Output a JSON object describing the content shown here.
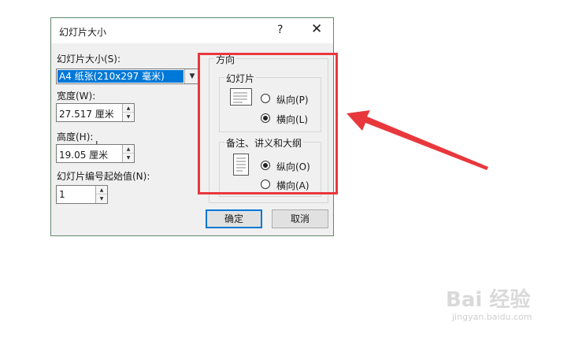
{
  "dialog": {
    "title": "幻灯片大小",
    "help_label": "?",
    "close_label": "✕",
    "slide_size_label": "幻灯片大小(S):",
    "slide_size_value": "A4 纸张(210x297 毫米)",
    "width_label": "宽度(W):",
    "width_value": "27.517 厘米",
    "height_label": "高度(H):",
    "height_value": "19.05 厘米",
    "start_number_label": "幻灯片编号起始值(N):",
    "start_number_value": "1",
    "orientation": {
      "title": "方向",
      "slides": {
        "title": "幻灯片",
        "portrait_label": "纵向(P)",
        "landscape_label": "横向(L)",
        "selected": "landscape"
      },
      "notes": {
        "title": "备注、讲义和大纲",
        "portrait_label": "纵向(O)",
        "landscape_label": "横向(A)",
        "selected": "portrait"
      }
    },
    "ok_label": "确定",
    "cancel_label": "取消"
  },
  "annotation": {
    "highlight_color": "#e8383d",
    "arrow_color": "#e8383d"
  },
  "watermark": {
    "logo_text": "Bai 经验",
    "url": "jingyan.baidu.com"
  }
}
